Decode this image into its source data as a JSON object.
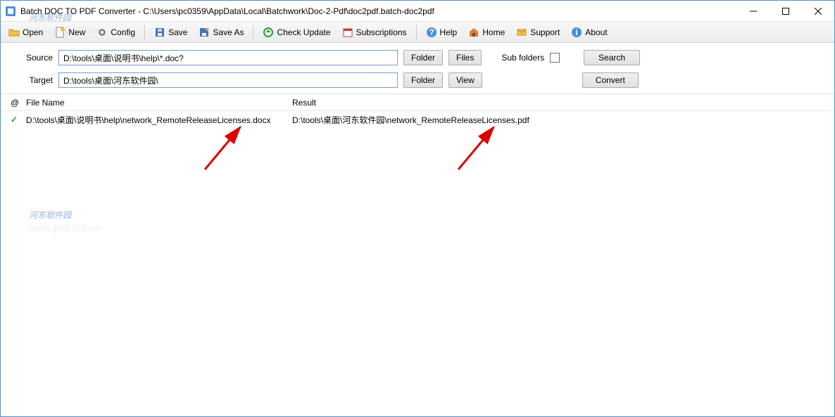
{
  "window": {
    "title": "Batch DOC TO PDF Converter - C:\\Users\\pc0359\\AppData\\Local\\Batchwork\\Doc-2-Pdf\\doc2pdf.batch-doc2pdf"
  },
  "toolbar": {
    "open": "Open",
    "new": "New",
    "config": "Config",
    "save": "Save",
    "saveas": "Save As",
    "check_update": "Check Update",
    "subscriptions": "Subscriptions",
    "help": "Help",
    "home": "Home",
    "support": "Support",
    "about": "About"
  },
  "form": {
    "source_label": "Source",
    "source_value": "D:\\tools\\桌面\\说明书\\help\\*.doc?",
    "target_label": "Target",
    "target_value": "D:\\tools\\桌面\\河东软件园\\",
    "folder_btn": "Folder",
    "files_btn": "Files",
    "view_btn": "View",
    "sub_folders": "Sub folders",
    "search_btn": "Search",
    "convert_btn": "Convert"
  },
  "list": {
    "hdr_at": "@",
    "hdr_file": "File Name",
    "hdr_result": "Result",
    "rows": [
      {
        "file": "D:\\tools\\桌面\\说明书\\help\\network_RemoteReleaseLicenses.docx",
        "result": "D:\\tools\\桌面\\河东软件园\\network_RemoteReleaseLicenses.pdf"
      }
    ]
  },
  "watermark": {
    "line1": "河东软件园",
    "line2": "www.pc0359.cn"
  }
}
